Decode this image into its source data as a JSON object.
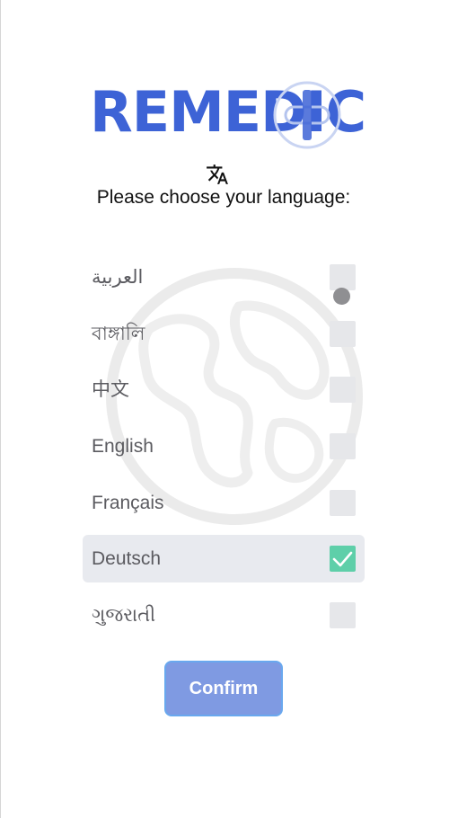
{
  "app": {
    "logo_text": "REMEDIC"
  },
  "header": {
    "translate_icon": "translate-icon",
    "title": "Please choose your language:"
  },
  "languages": [
    {
      "label": "العربية",
      "checked": false
    },
    {
      "label": "বাঙ্গালি",
      "checked": false
    },
    {
      "label": "中文",
      "checked": false
    },
    {
      "label": "English",
      "checked": false
    },
    {
      "label": "Français",
      "checked": false
    },
    {
      "label": "Deutsch",
      "checked": true
    },
    {
      "label": "ગુજરાતી",
      "checked": false
    }
  ],
  "selected_language": "Deutsch",
  "confirm_label": "Confirm",
  "colors": {
    "brand_blue": "#3d63d6",
    "check_green": "#5ecfa9",
    "button_fill": "#7f9ae2",
    "button_border": "#69a8ee"
  },
  "icons": {
    "background": "globe-icon",
    "check": "checkmark-icon"
  }
}
